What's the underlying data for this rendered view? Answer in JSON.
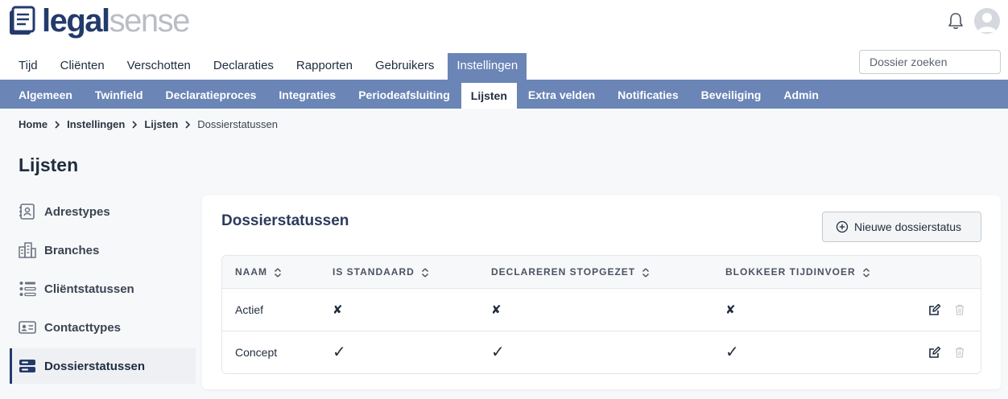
{
  "brand": {
    "part1": "legal",
    "part2": "sense"
  },
  "main_nav": [
    {
      "label": "Tijd",
      "active": false
    },
    {
      "label": "Cliënten",
      "active": false
    },
    {
      "label": "Verschotten",
      "active": false
    },
    {
      "label": "Declaraties",
      "active": false
    },
    {
      "label": "Rapporten",
      "active": false
    },
    {
      "label": "Gebruikers",
      "active": false
    },
    {
      "label": "Instellingen",
      "active": true
    }
  ],
  "search": {
    "placeholder": "Dossier zoeken"
  },
  "sub_nav": [
    {
      "label": "Algemeen",
      "active": false
    },
    {
      "label": "Twinfield",
      "active": false
    },
    {
      "label": "Declaratieproces",
      "active": false
    },
    {
      "label": "Integraties",
      "active": false
    },
    {
      "label": "Periodeafsluiting",
      "active": false
    },
    {
      "label": "Lijsten",
      "active": true
    },
    {
      "label": "Extra velden",
      "active": false
    },
    {
      "label": "Notificaties",
      "active": false
    },
    {
      "label": "Beveiliging",
      "active": false
    },
    {
      "label": "Admin",
      "active": false
    }
  ],
  "breadcrumb": {
    "items": [
      "Home",
      "Instellingen",
      "Lijsten"
    ],
    "current": "Dossierstatussen"
  },
  "page_title": "Lijsten",
  "sidebar": {
    "items": [
      {
        "label": "Adrestypes",
        "icon": "address-book-icon",
        "active": false
      },
      {
        "label": "Branches",
        "icon": "buildings-icon",
        "active": false
      },
      {
        "label": "Cliëntstatussen",
        "icon": "list-status-icon",
        "active": false
      },
      {
        "label": "Contacttypes",
        "icon": "id-card-icon",
        "active": false
      },
      {
        "label": "Dossierstatussen",
        "icon": "server-status-icon",
        "active": true
      }
    ]
  },
  "card": {
    "title": "Dossierstatussen",
    "new_button": "Nieuwe dossierstatus",
    "columns": [
      "NAAM",
      "IS STANDAARD",
      "DECLAREREN STOPGEZET",
      "BLOKKEER TIJDINVOER"
    ],
    "rows": [
      {
        "name": "Actief",
        "is_standaard": "✘",
        "declareren_stopgezet": "✘",
        "blokkeer_tijdinvoer": "✘"
      },
      {
        "name": "Concept",
        "is_standaard": "✓",
        "declareren_stopgezet": "✓",
        "blokkeer_tijdinvoer": "✓"
      }
    ]
  },
  "colors": {
    "accent": "#6a85b6",
    "brand_dark": "#233a6b",
    "brand_light": "#b9bdc4"
  }
}
